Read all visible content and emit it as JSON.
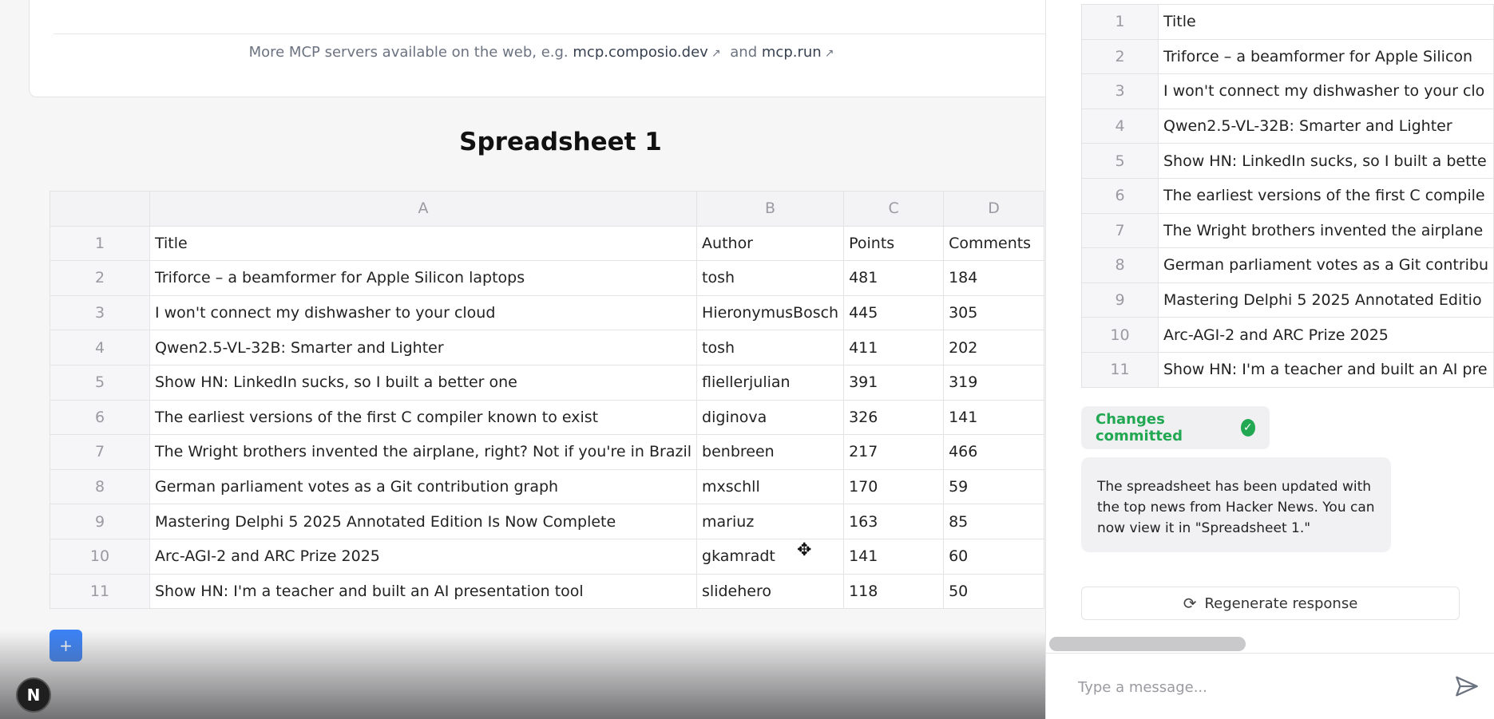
{
  "mcp": {
    "prefix": "More MCP servers available on the web, e.g. ",
    "link1": "mcp.composio.dev",
    "and": "and",
    "link2": "mcp.run"
  },
  "sheet": {
    "title": "Spreadsheet 1",
    "columns": [
      "A",
      "B",
      "C",
      "D"
    ],
    "rows": [
      [
        "1",
        "Title",
        "Author",
        "Points",
        "Comments"
      ],
      [
        "2",
        "Triforce – a beamformer for Apple Silicon laptops",
        "tosh",
        "481",
        "184"
      ],
      [
        "3",
        "I won't connect my dishwasher to your cloud",
        "HieronymusBosch",
        "445",
        "305"
      ],
      [
        "4",
        "Qwen2.5-VL-32B: Smarter and Lighter",
        "tosh",
        "411",
        "202"
      ],
      [
        "5",
        "Show HN: LinkedIn sucks, so I built a better one",
        "fliellerjulian",
        "391",
        "319"
      ],
      [
        "6",
        "The earliest versions of the first C compiler known to exist",
        "diginova",
        "326",
        "141"
      ],
      [
        "7",
        "The Wright brothers invented the airplane, right? Not if you're in Brazil",
        "benbreen",
        "217",
        "466"
      ],
      [
        "8",
        "German parliament votes as a Git contribution graph",
        "mxschll",
        "170",
        "59"
      ],
      [
        "9",
        "Mastering Delphi 5 2025 Annotated Edition Is Now Complete",
        "mariuz",
        "163",
        "85"
      ],
      [
        "10",
        "Arc-AGI-2 and ARC Prize 2025",
        "gkamradt",
        "141",
        "60"
      ],
      [
        "11",
        "Show HN: I'm a teacher and built an AI presentation tool",
        "slidehero",
        "118",
        "50"
      ]
    ],
    "add_label": "+"
  },
  "badge": {
    "letter": "N"
  },
  "panel": {
    "mini_rows": [
      [
        "1",
        "Title"
      ],
      [
        "2",
        "Triforce – a beamformer for Apple Silicon"
      ],
      [
        "3",
        "I won't connect my dishwasher to your clo"
      ],
      [
        "4",
        "Qwen2.5-VL-32B: Smarter and Lighter"
      ],
      [
        "5",
        "Show HN: LinkedIn sucks, so I built a bette"
      ],
      [
        "6",
        "The earliest versions of the first C compile"
      ],
      [
        "7",
        "The Wright brothers invented the airplane"
      ],
      [
        "8",
        "German parliament votes as a Git contribu"
      ],
      [
        "9",
        "Mastering Delphi 5 2025 Annotated Editio"
      ],
      [
        "10",
        "Arc-AGI-2 and ARC Prize 2025"
      ],
      [
        "11",
        "Show HN: I'm a teacher and built an AI pre"
      ]
    ],
    "committed": "Changes committed",
    "message": "The spreadsheet has been updated with the top news from Hacker News. You can now view it in \"Spreadsheet 1.\"",
    "regenerate": "Regenerate response",
    "input_placeholder": "Type a message..."
  },
  "colors": {
    "accent": "#3b82f6",
    "success": "#22a852"
  }
}
